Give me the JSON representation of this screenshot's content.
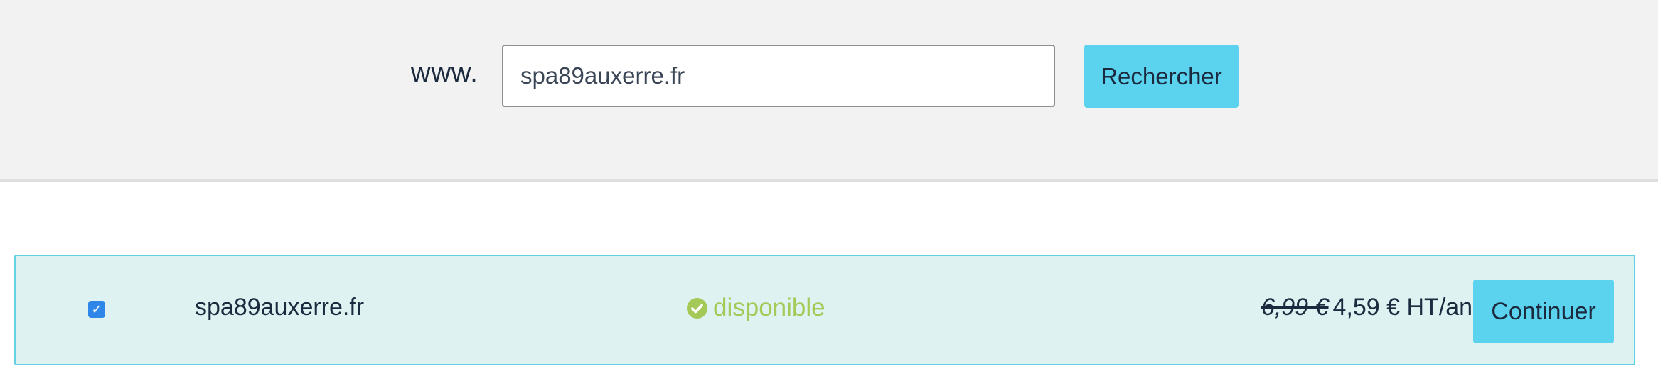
{
  "search": {
    "prefix": "www.",
    "value": "spa89auxerre.fr",
    "button_label": "Rechercher"
  },
  "result": {
    "checked": true,
    "domain": "spa89auxerre.fr",
    "status_icon": "check-circle-icon",
    "status_label": "disponible",
    "old_price": "6,99 €",
    "new_price": "4,59 € HT/an",
    "continue_label": "Continuer"
  },
  "colors": {
    "accent": "#5bd2ee",
    "available": "#a5c957",
    "row_background": "#ddf2f1",
    "checkbox": "#2e86e8"
  }
}
